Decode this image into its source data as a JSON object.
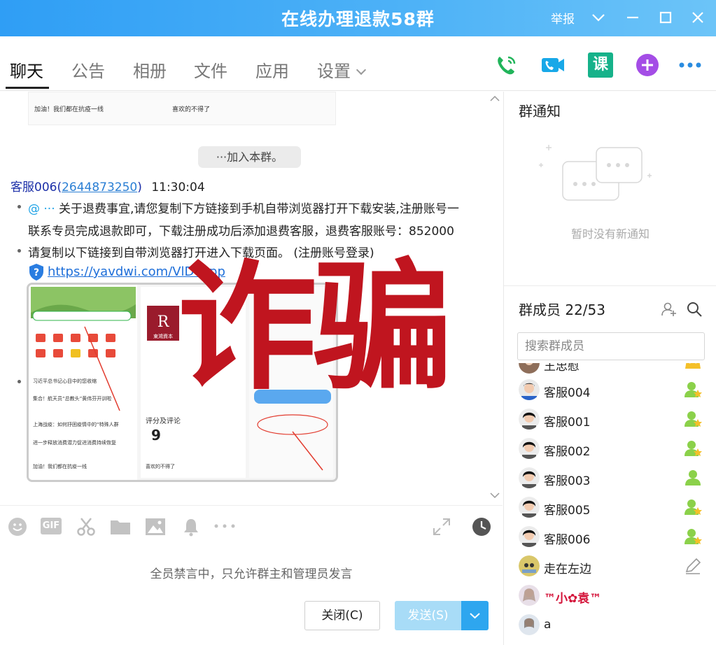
{
  "window": {
    "title": "在线办理退款58群",
    "report_label": "举报"
  },
  "tabs": [
    {
      "label": "聊天",
      "active": true
    },
    {
      "label": "公告"
    },
    {
      "label": "相册"
    },
    {
      "label": "文件"
    },
    {
      "label": "应用"
    },
    {
      "label": "设置"
    }
  ],
  "toolbar_icons": [
    "phone-call-icon",
    "video-call-icon",
    "class-icon",
    "add-app-icon",
    "more-icon"
  ],
  "toolbar_class_label": "课",
  "chat": {
    "prev_card_text_left": "加油！我们都在抗疫一线",
    "prev_card_text_right": "喜欢的不得了",
    "system_message": "···加入本群。",
    "sender_name": "客服006(",
    "sender_qq": "2644873250",
    "sender_close": ")",
    "sender_time": "11:30:04",
    "at_prefix": "@ ···",
    "message_line1": "关于退费事宜,请您复制下方链接到手机自带浏览器打开下载安装,注册账号一",
    "message_line2": "联系专员完成退款即可，下载注册成功后添加退费客服，退费客服账号：852000",
    "message_line3": "请复制以下链接到自带浏览器打开进入下载页面。 (注册账号登录)",
    "link_text": "https://yavdwi.com/VlDVapp",
    "overlay_text": "诈骗",
    "shot_rating_label": "评分及评论",
    "shot_rating_value": "9",
    "shot_news": [
      "习近平总书记心目中的您收缩",
      "集合！航天员“总教头”黄伟芬开训啦",
      "上海战疫：如何抒困疫情中的“特殊人群",
      "进一步释放消费潜力促进消费持续恢复",
      "加油！我们都在抗疫一线"
    ],
    "shot_logo_text": "東鴻資本",
    "shot_review": "喜欢的不得了"
  },
  "input": {
    "tool_icons": [
      "emoji-icon",
      "gif-icon",
      "screenshot-scissors-icon",
      "folder-icon",
      "image-icon",
      "bell-icon",
      "more-dots-icon"
    ],
    "gif_label": "GIF",
    "mute_notice": "全员禁言中，只允许群主和管理员发言",
    "close_button": "关闭(C)",
    "send_button": "发送(S)"
  },
  "sidebar": {
    "notice_title": "群通知",
    "notice_empty": "暂时没有新通知",
    "members_title": "群成员 22/53",
    "search_placeholder": "搜索群成员",
    "members": [
      {
        "name": "王忠慰",
        "role": "owner"
      },
      {
        "name": "客服004",
        "role": "admin"
      },
      {
        "name": "客服001",
        "role": "admin"
      },
      {
        "name": "客服002",
        "role": "admin"
      },
      {
        "name": "客服003",
        "role": "member"
      },
      {
        "name": "客服005",
        "role": "admin"
      },
      {
        "name": "客服006",
        "role": "admin"
      },
      {
        "name": "走在左边",
        "role": "edit"
      },
      {
        "name": "™小✿袁™",
        "role": "none",
        "highlight": true
      },
      {
        "name": "a",
        "role": "none"
      }
    ]
  },
  "colors": {
    "titlebar": "#2f9ef5",
    "scam_overlay": "#c0151f",
    "sender": "#1c2fa8",
    "link": "#1e6fd9",
    "send_button": "#a8dcf7"
  }
}
